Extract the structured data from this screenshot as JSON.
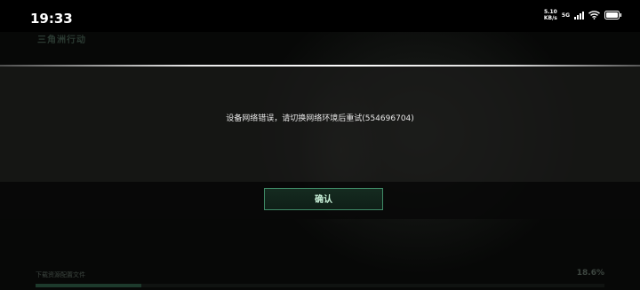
{
  "status_bar": {
    "time": "19:33",
    "net_speed_value": "5.10",
    "net_speed_unit": "KB/s",
    "network_type": "5G"
  },
  "background": {
    "logo_text": "三角洲行动"
  },
  "dialog": {
    "message": "设备网络错误，请切换网络环境后重试(554696704)",
    "confirm_label": "确认"
  },
  "loading": {
    "label": "下载资源配置文件",
    "percent_text": "18.6%",
    "progress": 0.186
  },
  "colors": {
    "accent_green": "#3f8a66",
    "button_text": "#c8f0d8"
  }
}
